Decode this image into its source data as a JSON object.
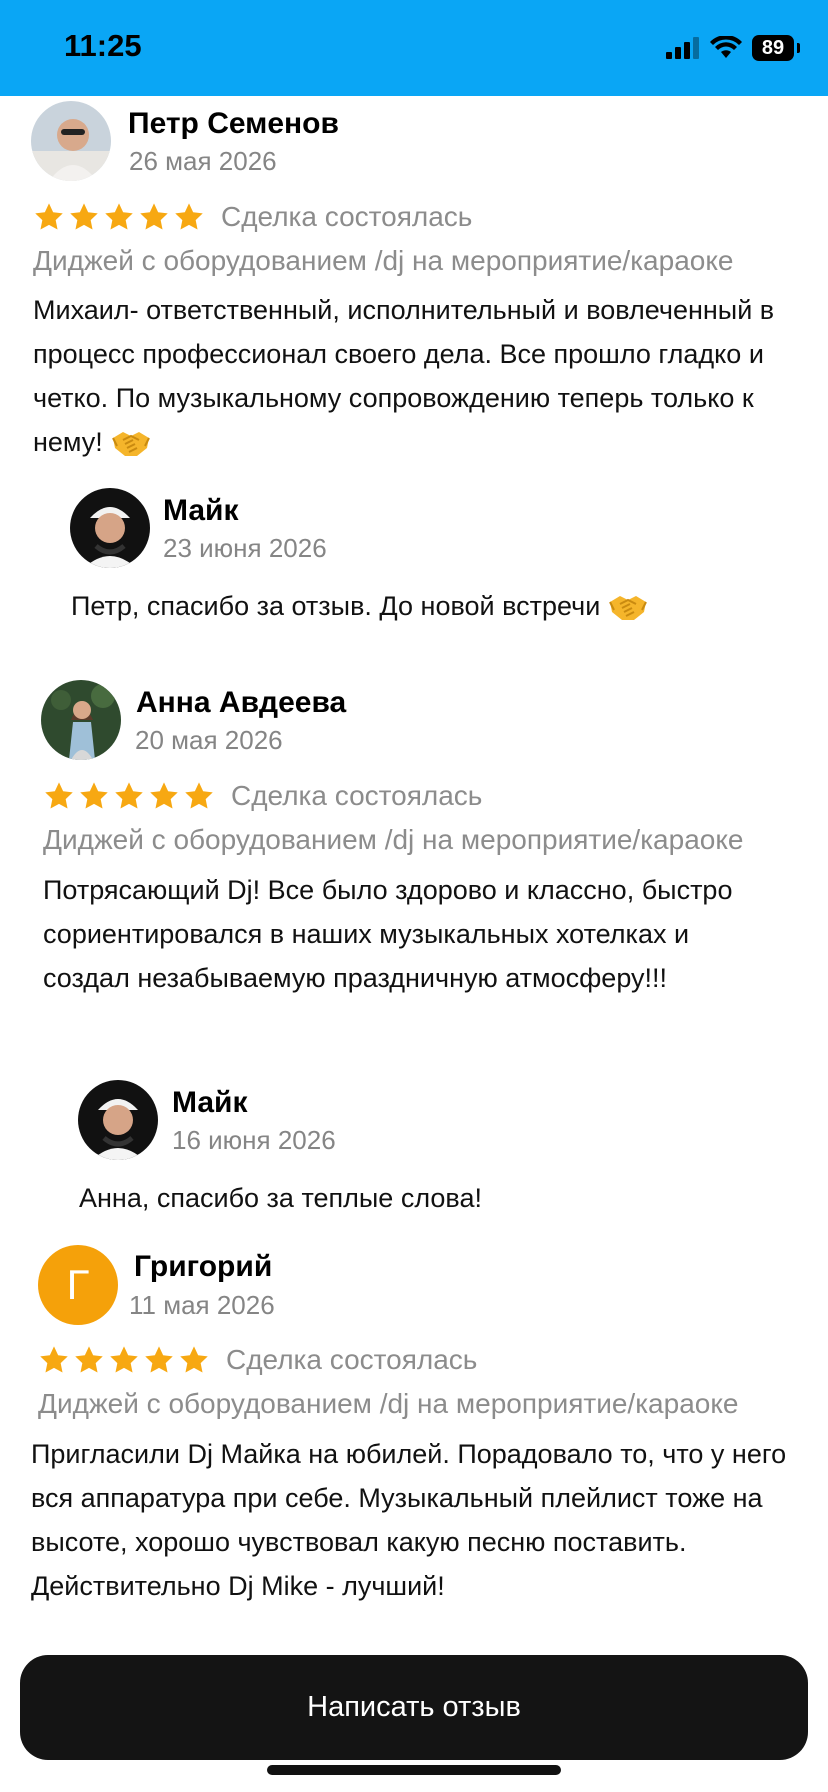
{
  "status_bar": {
    "time": "11:25",
    "battery": "89",
    "color": "#0aa6f5"
  },
  "star_color": "#f7a812",
  "reviews": [
    {
      "name": "Петр Семенов",
      "date": "26 мая 2026",
      "rating": 5,
      "deal": "Сделка состоялась",
      "service": "Диджей с оборудованием /dj на мероприятие/караоке",
      "text": "Михаил-  ответственный, исполнительный и вовлеченный в процесс профессионал своего дела. Все прошло гладко и четко. По музыкальному сопровождению теперь только к нему!",
      "reply": {
        "name": "Майк",
        "date": "23 июня 2026",
        "text": "Петр, спасибо за отзыв. До новой встречи"
      }
    },
    {
      "name": "Анна Авдеева",
      "date": "20 мая 2026",
      "rating": 5,
      "deal": "Сделка состоялась",
      "service": "Диджей с оборудованием /dj на мероприятие/караоке",
      "text": "Потрясающий Dj! Все было здорово и классно, быстро сориентировался в наших музыкальных хотелках и создал незабываемую праздничную атмосферу!!!",
      "reply": {
        "name": "Майк",
        "date": "16 июня 2026",
        "text": "Анна, спасибо за теплые слова!"
      }
    },
    {
      "name": "Григорий",
      "avatar_letter": "Г",
      "avatar_color": "#f5a10a",
      "date": "11 мая 2026",
      "rating": 5,
      "deal": "Сделка состоялась",
      "service": "Диджей с оборудованием /dj на мероприятие/караоке",
      "text": "Пригласили Dj Майка на юбилей. Порадовало то, что у него вся аппаратура при себе. Музыкальный плейлист тоже на высоте, хорошо чувствовал какую песню поставить. Действительно Dj Mike - лучший!"
    }
  ],
  "write_review_button": "Написать отзыв"
}
